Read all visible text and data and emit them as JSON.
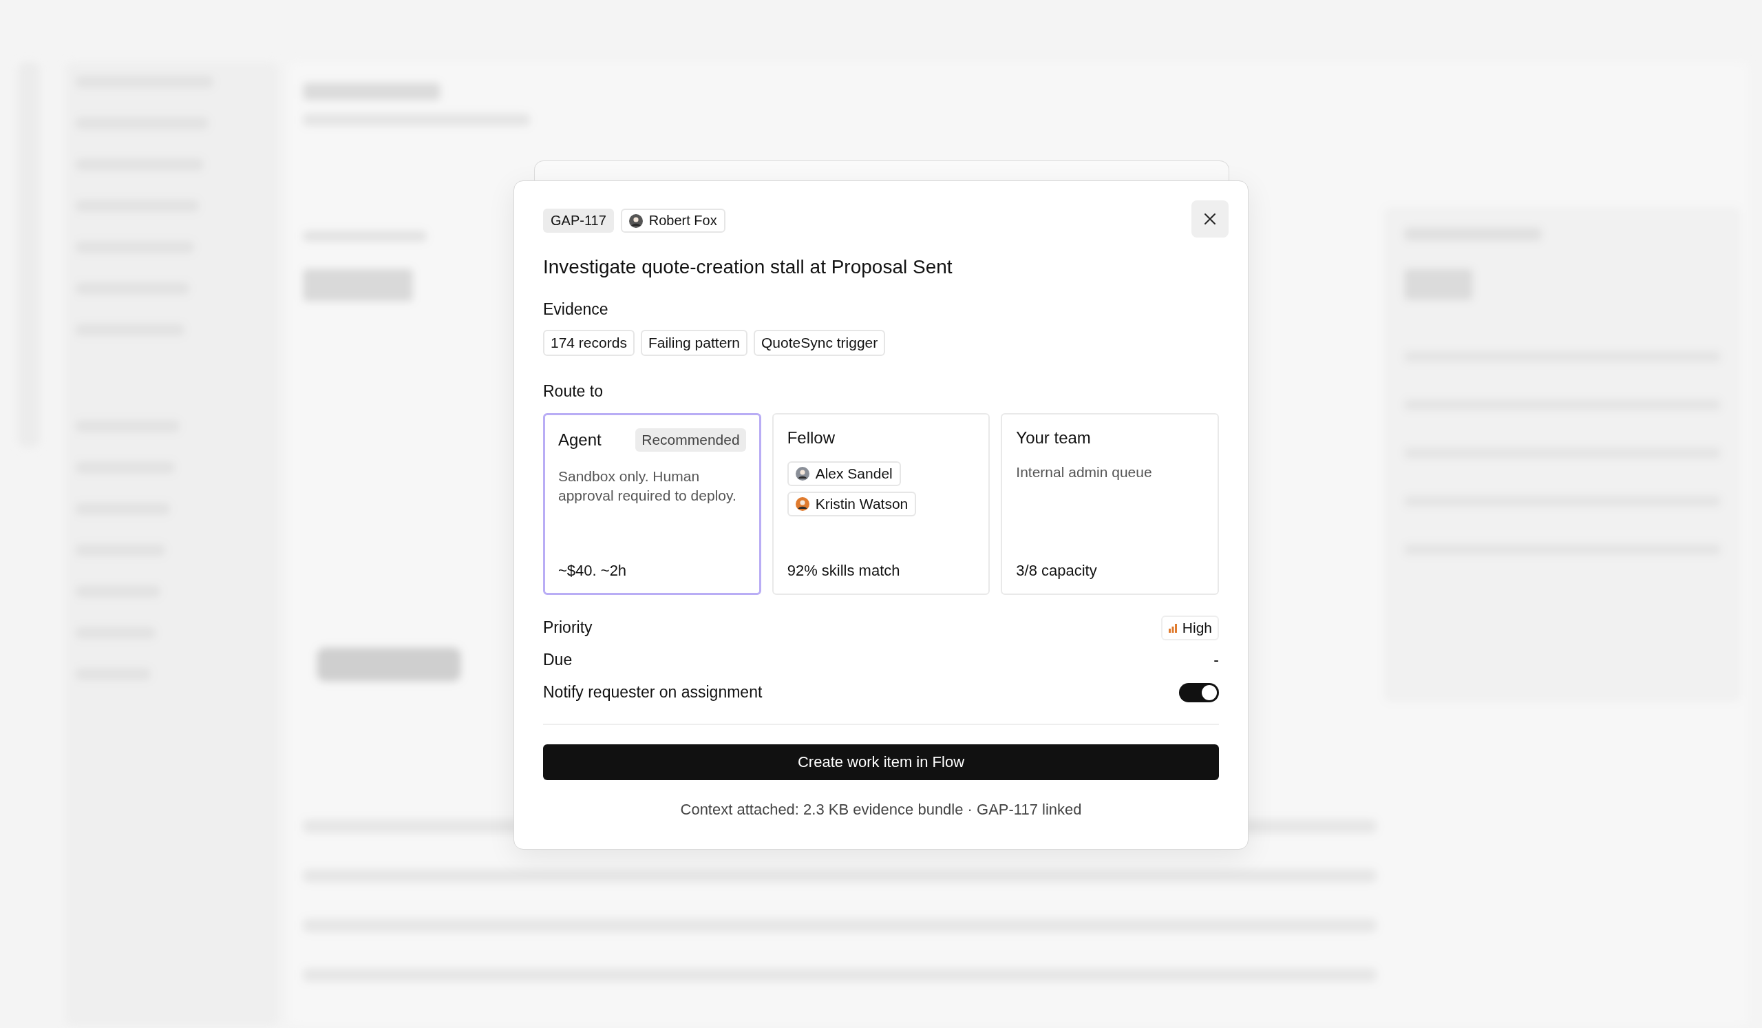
{
  "modal": {
    "id_tag": "GAP-117",
    "owner": "Robert Fox",
    "title": "Investigate quote-creation stall at Proposal Sent",
    "evidence": {
      "label": "Evidence",
      "chips": [
        "174 records",
        "Failing pattern",
        "QuoteSync trigger"
      ]
    },
    "route": {
      "label": "Route to",
      "options": [
        {
          "kind": "agent",
          "title": "Agent",
          "badge": "Recommended",
          "selected": true,
          "description": "Sandbox only. Human approval required to deploy.",
          "footer": "~$40. ~2h"
        },
        {
          "kind": "people",
          "title": "Fellow",
          "selected": false,
          "people": [
            {
              "name": "Alex Sandel",
              "color": "#8a8f98"
            },
            {
              "name": "Kristin Watson",
              "color": "#e07b2e"
            }
          ],
          "footer": "92% skills match"
        },
        {
          "kind": "team",
          "title": "Your team",
          "selected": false,
          "description": "Internal admin queue",
          "footer": "3/8 capacity"
        }
      ]
    },
    "priority": {
      "label": "Priority",
      "value": "High"
    },
    "due": {
      "label": "Due",
      "value": "-"
    },
    "notify": {
      "label": "Notify requester on assignment",
      "on": true
    },
    "submit": "Create work item in Flow",
    "context": "Context attached: 2.3 KB evidence bundle · GAP-117 linked"
  }
}
